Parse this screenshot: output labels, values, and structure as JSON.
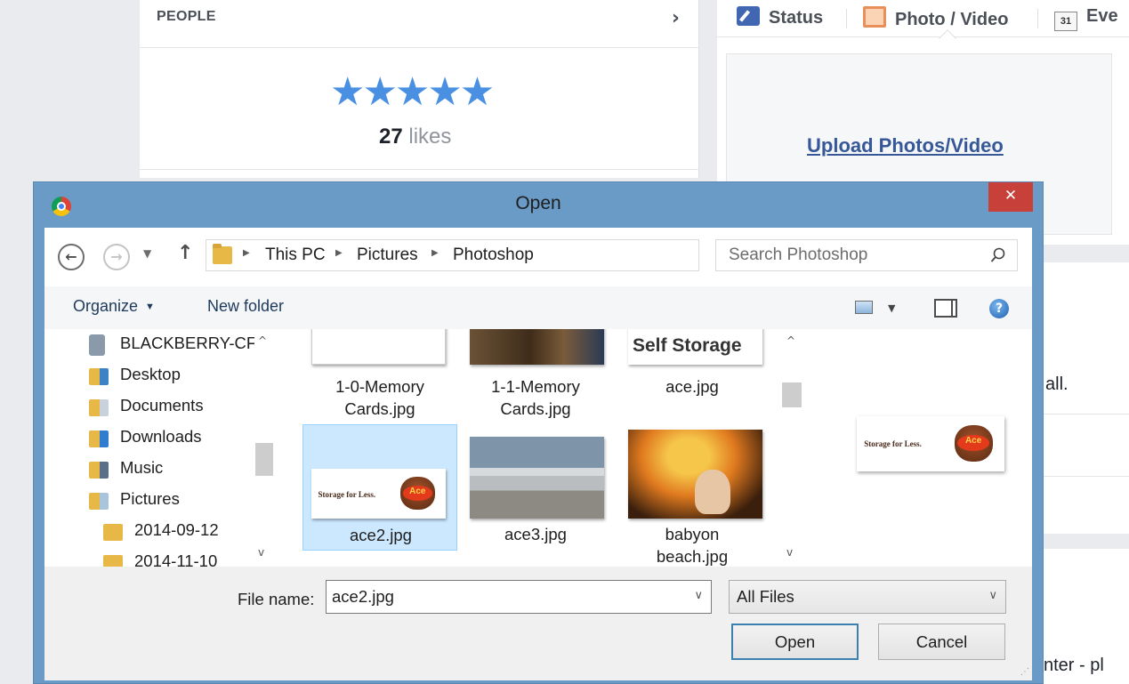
{
  "background": {
    "people": {
      "title": "PEOPLE",
      "stars": "★★★★★",
      "rating": 5,
      "likes_count": "27",
      "likes_label": "likes"
    },
    "composer": {
      "tabs": [
        {
          "label": "Status",
          "icon": "pencil-icon"
        },
        {
          "label": "Photo / Video",
          "icon": "photo-icon"
        },
        {
          "label": "Eve",
          "icon": "calendar-icon",
          "icon_text": "31"
        }
      ],
      "upload_link": "Upload Photos/Video"
    },
    "right_fragments": [
      "all.",
      "nter - pl"
    ]
  },
  "dialog": {
    "title": "Open",
    "close_symbol": "✕",
    "breadcrumbs": [
      "This PC",
      "Pictures",
      "Photoshop"
    ],
    "search": {
      "placeholder": "Search Photoshop"
    },
    "toolbar": {
      "organize_label": "Organize",
      "new_folder_label": "New folder"
    },
    "nav_items": [
      {
        "label": "BLACKBERRY-CF",
        "icon": "device-icon"
      },
      {
        "label": "Desktop",
        "icon": "desktop-folder-icon"
      },
      {
        "label": "Documents",
        "icon": "documents-folder-icon"
      },
      {
        "label": "Downloads",
        "icon": "downloads-folder-icon"
      },
      {
        "label": "Music",
        "icon": "music-folder-icon"
      },
      {
        "label": "Pictures",
        "icon": "pictures-folder-icon"
      },
      {
        "label": "2014-09-12",
        "icon": "folder-icon"
      },
      {
        "label": "2014-11-10",
        "icon": "folder-icon"
      }
    ],
    "files": [
      {
        "line1": "1-0-Memory",
        "line2": "Cards.jpg"
      },
      {
        "line1": "1-1-Memory",
        "line2": "Cards.jpg"
      },
      {
        "line1": "ace.jpg",
        "line2": "",
        "thumb_text": "Self Storage"
      },
      {
        "line1": "ace2.jpg",
        "line2": "",
        "selected": true,
        "thumb_text": "Storage for Less.",
        "logo_text": "Ace"
      },
      {
        "line1": "ace3.jpg",
        "line2": ""
      },
      {
        "line1": "babyon",
        "line2": "beach.jpg"
      }
    ],
    "preview": {
      "thumb_text": "Storage for Less.",
      "logo_text": "Ace"
    },
    "file_name": {
      "label": "File name:",
      "value": "ace2.jpg"
    },
    "file_type": {
      "selected": "All Files"
    },
    "buttons": {
      "open": "Open",
      "cancel": "Cancel"
    },
    "colors": {
      "titlebar": "#6a9bc7",
      "close": "#c7403a",
      "selection": "#cce8ff"
    }
  }
}
